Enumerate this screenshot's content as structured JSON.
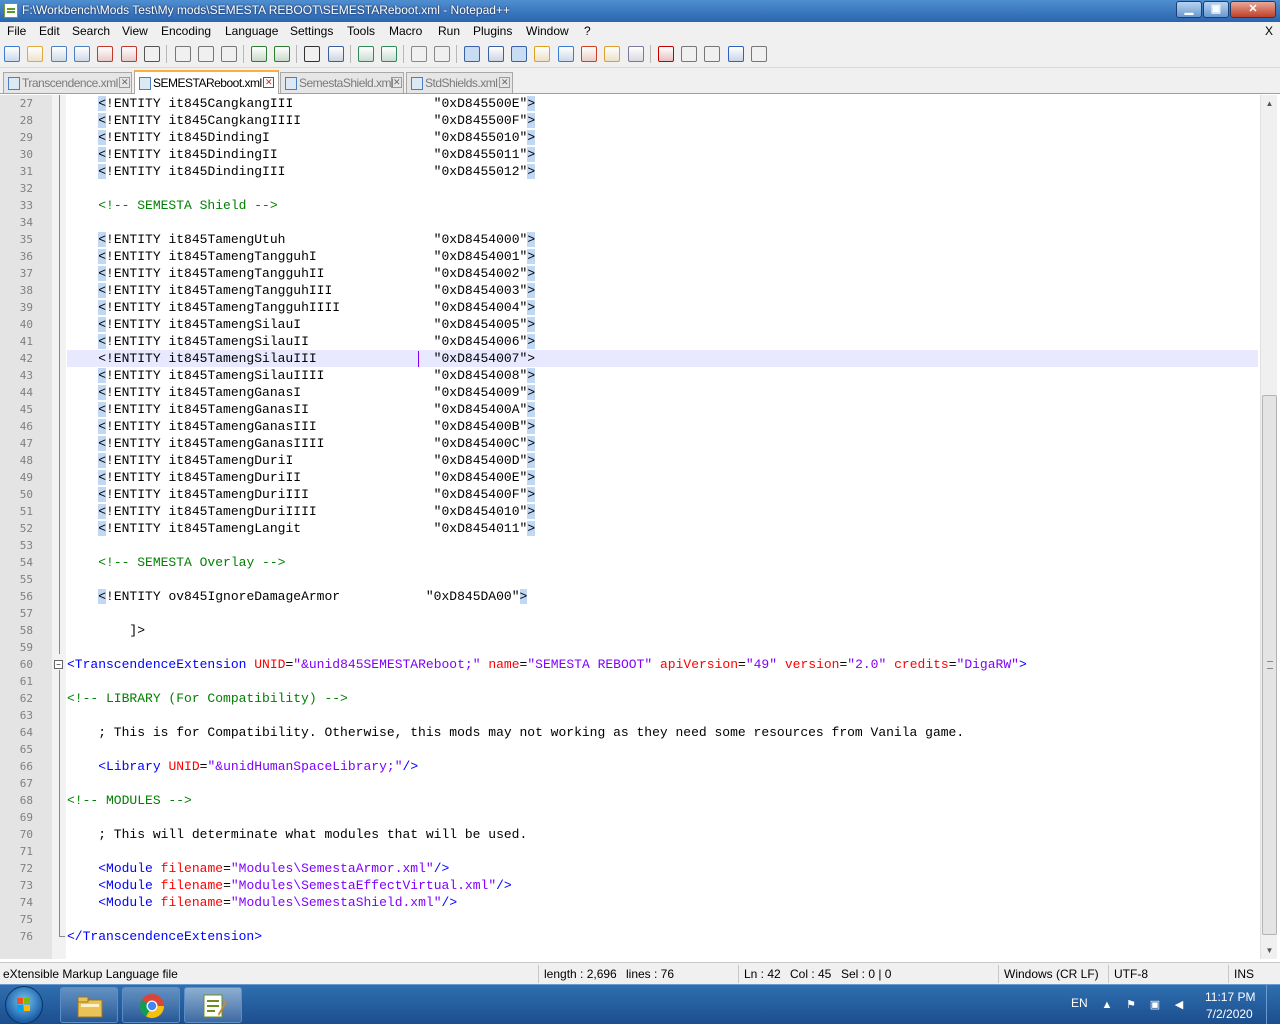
{
  "window": {
    "title": "F:\\Workbench\\Mods Test\\My mods\\SEMESTA REBOOT\\SEMESTAReboot.xml - Notepad++",
    "minimize_label": "▁",
    "maximize_label": "▣",
    "close_label": "✕"
  },
  "menu": {
    "items": [
      "File",
      "Edit",
      "Search",
      "View",
      "Encoding",
      "Language",
      "Settings",
      "Tools",
      "Macro",
      "Run",
      "Plugins",
      "Window",
      "?"
    ],
    "close_doc": "X"
  },
  "toolbar": {
    "icons": [
      "new-file-icon",
      "open-file-icon",
      "save-icon",
      "save-all-icon",
      "close-icon",
      "close-all-icon",
      "print-icon",
      "cut-icon",
      "copy-icon",
      "paste-icon",
      "undo-icon",
      "redo-icon",
      "find-icon",
      "replace-icon",
      "zoom-in-icon",
      "zoom-out-icon",
      "sync-vertical-icon",
      "sync-horizontal-icon",
      "word-wrap-icon",
      "show-all-chars-icon",
      "indent-guide-icon",
      "udl-icon",
      "doc-map-icon",
      "function-list-icon",
      "folder-workspace-icon",
      "monitoring-icon",
      "record-macro-icon",
      "stop-macro-icon",
      "play-macro-icon",
      "run-macro-multiple-icon",
      "save-macro-icon"
    ]
  },
  "tabs": [
    {
      "label": "Transcendence.xml",
      "active": false
    },
    {
      "label": "SEMESTAReboot.xml",
      "active": true
    },
    {
      "label": "SemestaShield.xml",
      "active": false
    },
    {
      "label": "StdShields.xml",
      "active": false
    }
  ],
  "editor": {
    "current_line": 42,
    "lines": [
      {
        "n": "27",
        "segs": [
          [
            "t",
            "    "
          ],
          [
            "h",
            "<"
          ],
          [
            "t",
            "!ENTITY it845CangkangIII                  \"0xD845500E\""
          ],
          [
            "h",
            ">"
          ]
        ]
      },
      {
        "n": "28",
        "segs": [
          [
            "t",
            "    "
          ],
          [
            "h",
            "<"
          ],
          [
            "t",
            "!ENTITY it845CangkangIIII                 \"0xD845500F\""
          ],
          [
            "h",
            ">"
          ]
        ]
      },
      {
        "n": "29",
        "segs": [
          [
            "t",
            "    "
          ],
          [
            "h",
            "<"
          ],
          [
            "t",
            "!ENTITY it845DindingI                     \"0xD8455010\""
          ],
          [
            "h",
            ">"
          ]
        ]
      },
      {
        "n": "30",
        "segs": [
          [
            "t",
            "    "
          ],
          [
            "h",
            "<"
          ],
          [
            "t",
            "!ENTITY it845DindingII                    \"0xD8455011\""
          ],
          [
            "h",
            ">"
          ]
        ]
      },
      {
        "n": "31",
        "segs": [
          [
            "t",
            "    "
          ],
          [
            "h",
            "<"
          ],
          [
            "t",
            "!ENTITY it845DindingIII                   \"0xD8455012\""
          ],
          [
            "h",
            ">"
          ]
        ]
      },
      {
        "n": "32",
        "segs": []
      },
      {
        "n": "33",
        "segs": [
          [
            "t",
            "    "
          ],
          [
            "cm",
            "<!-- SEMESTA Shield -->"
          ]
        ]
      },
      {
        "n": "34",
        "segs": []
      },
      {
        "n": "35",
        "segs": [
          [
            "t",
            "    "
          ],
          [
            "h",
            "<"
          ],
          [
            "t",
            "!ENTITY it845TamengUtuh                   \"0xD8454000\""
          ],
          [
            "h",
            ">"
          ]
        ]
      },
      {
        "n": "36",
        "segs": [
          [
            "t",
            "    "
          ],
          [
            "h",
            "<"
          ],
          [
            "t",
            "!ENTITY it845TamengTangguhI               \"0xD8454001\""
          ],
          [
            "h",
            ">"
          ]
        ]
      },
      {
        "n": "37",
        "segs": [
          [
            "t",
            "    "
          ],
          [
            "h",
            "<"
          ],
          [
            "t",
            "!ENTITY it845TamengTangguhII              \"0xD8454002\""
          ],
          [
            "h",
            ">"
          ]
        ]
      },
      {
        "n": "38",
        "segs": [
          [
            "t",
            "    "
          ],
          [
            "h",
            "<"
          ],
          [
            "t",
            "!ENTITY it845TamengTangguhIII             \"0xD8454003\""
          ],
          [
            "h",
            ">"
          ]
        ]
      },
      {
        "n": "39",
        "segs": [
          [
            "t",
            "    "
          ],
          [
            "h",
            "<"
          ],
          [
            "t",
            "!ENTITY it845TamengTangguhIIII            \"0xD8454004\""
          ],
          [
            "h",
            ">"
          ]
        ]
      },
      {
        "n": "40",
        "segs": [
          [
            "t",
            "    "
          ],
          [
            "h",
            "<"
          ],
          [
            "t",
            "!ENTITY it845TamengSilauI                 \"0xD8454005\""
          ],
          [
            "h",
            ">"
          ]
        ]
      },
      {
        "n": "41",
        "segs": [
          [
            "t",
            "    "
          ],
          [
            "h",
            "<"
          ],
          [
            "t",
            "!ENTITY it845TamengSilauII                \"0xD8454006\""
          ],
          [
            "h",
            ">"
          ]
        ]
      },
      {
        "n": "42",
        "segs": [
          [
            "t",
            "    <!ENTITY it845TamengSilauIII               \"0xD8454007\">"
          ]
        ]
      },
      {
        "n": "43",
        "segs": [
          [
            "t",
            "    "
          ],
          [
            "h",
            "<"
          ],
          [
            "t",
            "!ENTITY it845TamengSilauIIII              \"0xD8454008\""
          ],
          [
            "h",
            ">"
          ]
        ]
      },
      {
        "n": "44",
        "segs": [
          [
            "t",
            "    "
          ],
          [
            "h",
            "<"
          ],
          [
            "t",
            "!ENTITY it845TamengGanasI                 \"0xD8454009\""
          ],
          [
            "h",
            ">"
          ]
        ]
      },
      {
        "n": "45",
        "segs": [
          [
            "t",
            "    "
          ],
          [
            "h",
            "<"
          ],
          [
            "t",
            "!ENTITY it845TamengGanasII                \"0xD845400A\""
          ],
          [
            "h",
            ">"
          ]
        ]
      },
      {
        "n": "46",
        "segs": [
          [
            "t",
            "    "
          ],
          [
            "h",
            "<"
          ],
          [
            "t",
            "!ENTITY it845TamengGanasIII               \"0xD845400B\""
          ],
          [
            "h",
            ">"
          ]
        ]
      },
      {
        "n": "47",
        "segs": [
          [
            "t",
            "    "
          ],
          [
            "h",
            "<"
          ],
          [
            "t",
            "!ENTITY it845TamengGanasIIII              \"0xD845400C\""
          ],
          [
            "h",
            ">"
          ]
        ]
      },
      {
        "n": "48",
        "segs": [
          [
            "t",
            "    "
          ],
          [
            "h",
            "<"
          ],
          [
            "t",
            "!ENTITY it845TamengDuriI                  \"0xD845400D\""
          ],
          [
            "h",
            ">"
          ]
        ]
      },
      {
        "n": "49",
        "segs": [
          [
            "t",
            "    "
          ],
          [
            "h",
            "<"
          ],
          [
            "t",
            "!ENTITY it845TamengDuriII                 \"0xD845400E\""
          ],
          [
            "h",
            ">"
          ]
        ]
      },
      {
        "n": "50",
        "segs": [
          [
            "t",
            "    "
          ],
          [
            "h",
            "<"
          ],
          [
            "t",
            "!ENTITY it845TamengDuriIII                \"0xD845400F\""
          ],
          [
            "h",
            ">"
          ]
        ]
      },
      {
        "n": "51",
        "segs": [
          [
            "t",
            "    "
          ],
          [
            "h",
            "<"
          ],
          [
            "t",
            "!ENTITY it845TamengDuriIIII               \"0xD8454010\""
          ],
          [
            "h",
            ">"
          ]
        ]
      },
      {
        "n": "52",
        "segs": [
          [
            "t",
            "    "
          ],
          [
            "h",
            "<"
          ],
          [
            "t",
            "!ENTITY it845TamengLangit                 \"0xD8454011\""
          ],
          [
            "h",
            ">"
          ]
        ]
      },
      {
        "n": "53",
        "segs": []
      },
      {
        "n": "54",
        "segs": [
          [
            "t",
            "    "
          ],
          [
            "cm",
            "<!-- SEMESTA Overlay -->"
          ]
        ]
      },
      {
        "n": "55",
        "segs": []
      },
      {
        "n": "56",
        "segs": [
          [
            "t",
            "    "
          ],
          [
            "h",
            "<"
          ],
          [
            "t",
            "!ENTITY ov845IgnoreDamageArmor           \"0xD845DA00\""
          ],
          [
            "h",
            ">"
          ]
        ]
      },
      {
        "n": "57",
        "segs": []
      },
      {
        "n": "58",
        "segs": [
          [
            "t",
            "        ]>"
          ]
        ]
      },
      {
        "n": "59",
        "segs": []
      },
      {
        "n": "60",
        "segs": [
          [
            "tag",
            "<TranscendenceExtension"
          ],
          [
            "t",
            " "
          ],
          [
            "attr",
            "UNID"
          ],
          [
            "t",
            "="
          ],
          [
            "val",
            "\"&unid845SEMESTAReboot;\""
          ],
          [
            "t",
            " "
          ],
          [
            "attr",
            "name"
          ],
          [
            "t",
            "="
          ],
          [
            "val",
            "\"SEMESTA REBOOT\""
          ],
          [
            "t",
            " "
          ],
          [
            "attr",
            "apiVersion"
          ],
          [
            "t",
            "="
          ],
          [
            "val",
            "\"49\""
          ],
          [
            "t",
            " "
          ],
          [
            "attr",
            "version"
          ],
          [
            "t",
            "="
          ],
          [
            "val",
            "\"2.0\""
          ],
          [
            "t",
            " "
          ],
          [
            "attr",
            "credits"
          ],
          [
            "t",
            "="
          ],
          [
            "val",
            "\"DigaRW\""
          ],
          [
            "tag",
            ">"
          ]
        ]
      },
      {
        "n": "61",
        "segs": []
      },
      {
        "n": "62",
        "segs": [
          [
            "cm",
            "<!-- LIBRARY (For Compatibility) -->"
          ]
        ]
      },
      {
        "n": "63",
        "segs": []
      },
      {
        "n": "64",
        "segs": [
          [
            "t",
            "    ; This is for Compatibility. Otherwise, this mods may not working as they need some resources from Vanila game."
          ]
        ]
      },
      {
        "n": "65",
        "segs": []
      },
      {
        "n": "66",
        "segs": [
          [
            "t",
            "    "
          ],
          [
            "tag",
            "<Library"
          ],
          [
            "t",
            " "
          ],
          [
            "attr",
            "UNID"
          ],
          [
            "t",
            "="
          ],
          [
            "val",
            "\"&unidHumanSpaceLibrary;\""
          ],
          [
            "tag",
            "/>"
          ]
        ]
      },
      {
        "n": "67",
        "segs": []
      },
      {
        "n": "68",
        "segs": [
          [
            "cm",
            "<!-- MODULES -->"
          ]
        ]
      },
      {
        "n": "69",
        "segs": []
      },
      {
        "n": "70",
        "segs": [
          [
            "t",
            "    ; This will determinate what modules that will be used."
          ]
        ]
      },
      {
        "n": "71",
        "segs": []
      },
      {
        "n": "72",
        "segs": [
          [
            "t",
            "    "
          ],
          [
            "tag",
            "<Module"
          ],
          [
            "t",
            " "
          ],
          [
            "attr",
            "filename"
          ],
          [
            "t",
            "="
          ],
          [
            "val",
            "\"Modules\\SemestaArmor.xml\""
          ],
          [
            "tag",
            "/>"
          ]
        ]
      },
      {
        "n": "73",
        "segs": [
          [
            "t",
            "    "
          ],
          [
            "tag",
            "<Module"
          ],
          [
            "t",
            " "
          ],
          [
            "attr",
            "filename"
          ],
          [
            "t",
            "="
          ],
          [
            "val",
            "\"Modules\\SemestaEffectVirtual.xml\""
          ],
          [
            "tag",
            "/>"
          ]
        ]
      },
      {
        "n": "74",
        "segs": [
          [
            "t",
            "    "
          ],
          [
            "tag",
            "<Module"
          ],
          [
            "t",
            " "
          ],
          [
            "attr",
            "filename"
          ],
          [
            "t",
            "="
          ],
          [
            "val",
            "\"Modules\\SemestaShield.xml\""
          ],
          [
            "tag",
            "/>"
          ]
        ]
      },
      {
        "n": "75",
        "segs": []
      },
      {
        "n": "76",
        "segs": [
          [
            "tag",
            "</TranscendenceExtension>"
          ]
        ]
      }
    ]
  },
  "statusbar": {
    "filetype": "eXtensible Markup Language file",
    "length": "length : 2,696",
    "lines": "lines : 76",
    "ln": "Ln : 42",
    "col": "Col : 45",
    "sel": "Sel : 0 | 0",
    "eol": "Windows (CR LF)",
    "encoding": "UTF-8",
    "mode": "INS"
  },
  "taskbar": {
    "apps": [
      "explorer-icon",
      "chrome-icon",
      "notepad-plus-plus-icon"
    ],
    "lang": "EN",
    "time": "11:17 PM",
    "date": "7/2/2020"
  }
}
